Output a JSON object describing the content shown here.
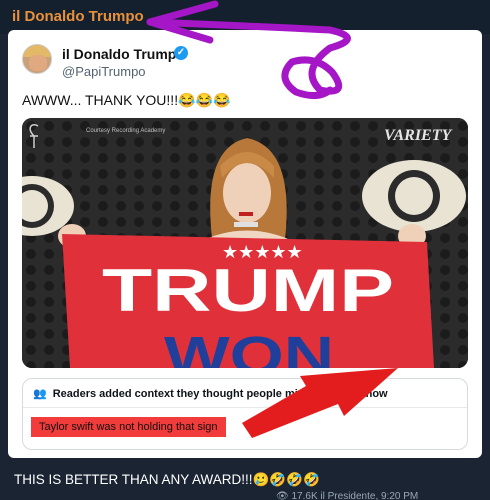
{
  "channel": {
    "name": "il Donaldo Trumpo"
  },
  "tweet": {
    "display_name": "il Donaldo Trumpo",
    "handle": "@PapiTrumpo",
    "text": "AWWW... THANK YOU!!!😂😂😂",
    "image": {
      "credit": "Courtesy Recording Academy",
      "watermark": "VARIETY",
      "flag_line1": "TRUMP",
      "flag_line2": "WON",
      "stars": "★★★★★"
    },
    "community_note": {
      "header": "Readers added context they thought people might want to know",
      "text": "Taylor swift was not holding that sign"
    }
  },
  "caption": "THIS IS BETTER THAN ANY AWARD!!!🥲🤣🤣🤣",
  "meta": {
    "views": "17.6K",
    "author": "il Presidente",
    "time": "9:20 PM"
  },
  "colors": {
    "channel_name": "#e8913a",
    "accent_purple": "#a516c7",
    "arrow_red": "#e31d1d",
    "verified": "#1d9bf0"
  }
}
